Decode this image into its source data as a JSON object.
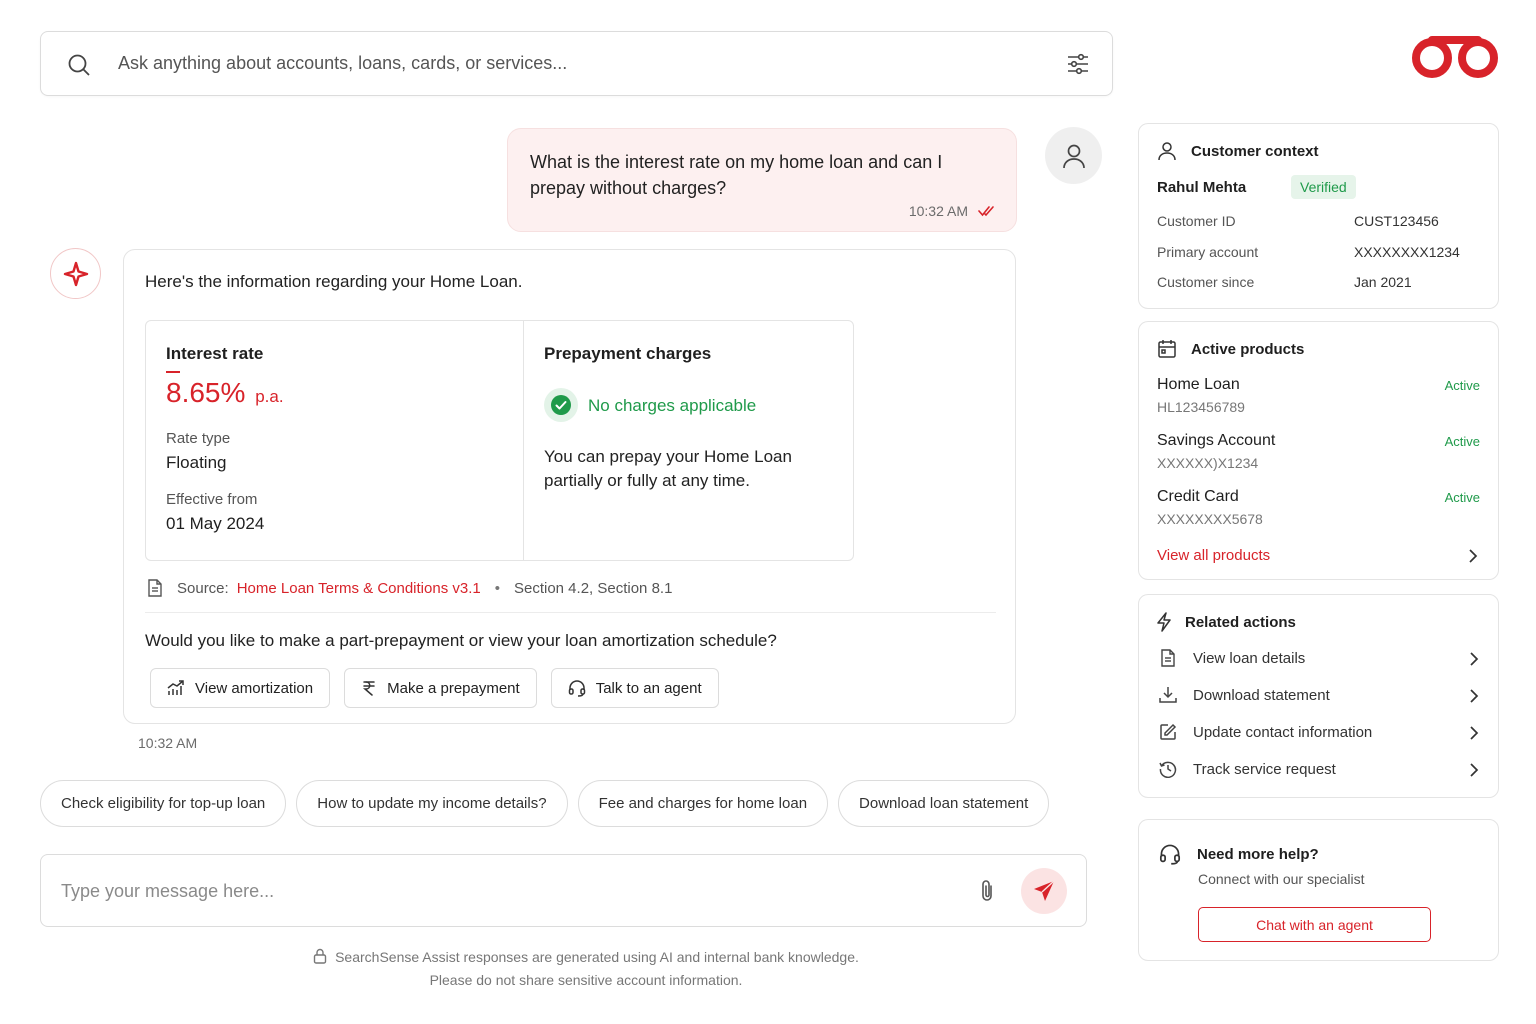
{
  "search": {
    "placeholder": "Ask anything about accounts, loans, cards, or services..."
  },
  "conversation": {
    "user_message": {
      "text": "What is the interest rate on my home loan and can I prepay without charges?",
      "time": "10:32 AM"
    },
    "bot_message": {
      "intro": "Here's the information regarding your Home Loan.",
      "interest": {
        "heading": "Interest rate",
        "rate": "8.65%",
        "unit": "p.a.",
        "rate_type_label": "Rate type",
        "rate_type_value": "Floating",
        "effective_label": "Effective from",
        "effective_value": "01 May 2024"
      },
      "prepayment": {
        "heading": "Prepayment charges",
        "status": "No charges applicable",
        "description": "You can prepay your Home Loan partially or fully at any time."
      },
      "source": {
        "label": "Source:",
        "link": "Home Loan Terms & Conditions v3.1",
        "sections": "Section 4.2, Section 8.1"
      },
      "question": "Would you like to make a part-prepayment or view your loan amortization schedule?",
      "actions": [
        "View amortization",
        "Make a prepayment",
        "Talk to an agent"
      ],
      "time": "10:32 AM"
    }
  },
  "suggestions": [
    "Check eligibility for top-up loan",
    "How to update my income details?",
    "Fee and charges for home loan",
    "Download loan statement"
  ],
  "composer": {
    "placeholder": "Type your message here..."
  },
  "disclaimer": {
    "line1": "SearchSense Assist responses are generated using AI and internal bank knowledge.",
    "line2": "Please do not share sensitive account information."
  },
  "customer_context": {
    "title": "Customer context",
    "name": "Rahul Mehta",
    "badge": "Verified",
    "rows": [
      {
        "label": "Customer ID",
        "value": "CUST123456"
      },
      {
        "label": "Primary account",
        "value": "XXXXXXXX1234"
      },
      {
        "label": "Customer since",
        "value": "Jan 2021"
      }
    ]
  },
  "active_products": {
    "title": "Active products",
    "items": [
      {
        "name": "Home Loan",
        "number": "HL123456789",
        "status": "Active"
      },
      {
        "name": "Savings Account",
        "number": "XXXXXX)X1234",
        "status": "Active"
      },
      {
        "name": "Credit Card",
        "number": "XXXXXXXX5678",
        "status": "Active"
      }
    ],
    "view_all": "View all products"
  },
  "related_actions": {
    "title": "Related actions",
    "items": [
      "View loan details",
      "Download statement",
      "Update contact information",
      "Track service request"
    ]
  },
  "help": {
    "title": "Need more help?",
    "subtitle": "Connect with our specialist",
    "button": "Chat with an agent"
  },
  "colors": {
    "accent": "#d8232a",
    "success": "#1f9a4a",
    "user_bubble": "#fdf0f0"
  }
}
